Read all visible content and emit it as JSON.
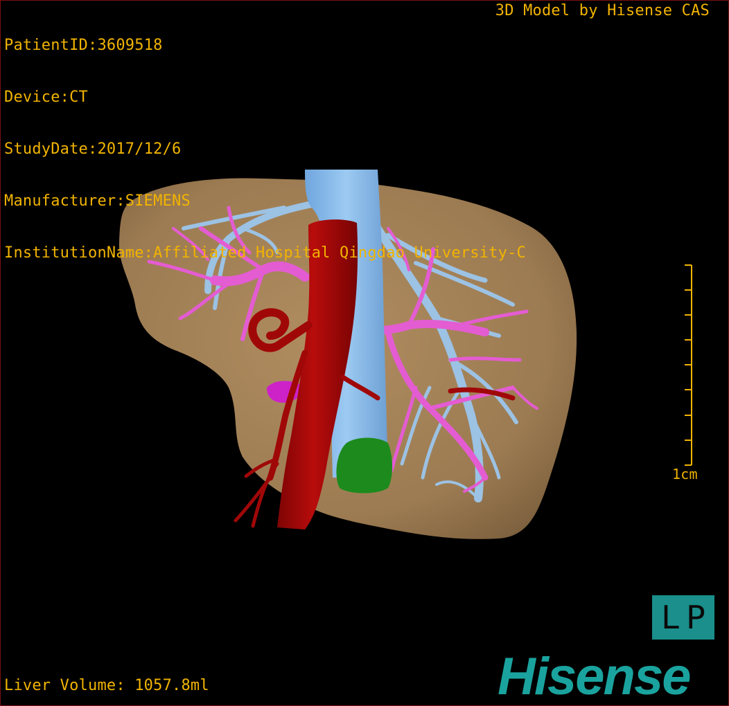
{
  "patient_info": {
    "patient_id": "PatientID:3609518",
    "device": "Device:CT",
    "study_date": "StudyDate:2017/12/6",
    "manufacturer": "Manufacturer:SIEMENS",
    "institution": "InstitutionName:Affiliated Hospital Qingdao University-C"
  },
  "model_credit": "3D Model by Hisense CAS",
  "liver_volume": "Liver Volume: 1057.8ml",
  "scale_label": "1cm",
  "orientation": {
    "left": "L",
    "right": "P"
  },
  "logo_text": "Hisense",
  "colors": {
    "overlay_text": "#f2b400",
    "liver": "#a6845a",
    "hepatic_artery": "#a00808",
    "portal_vein": "#e45cd2",
    "hepatic_vein": "#9cc2e4",
    "inferior_vena_cava": "#7fb4e6",
    "gallbladder": "#1d8a1d",
    "logo": "#1aa39e"
  },
  "icons": [
    "orientation-cube-icon",
    "scale-bar-icon"
  ]
}
